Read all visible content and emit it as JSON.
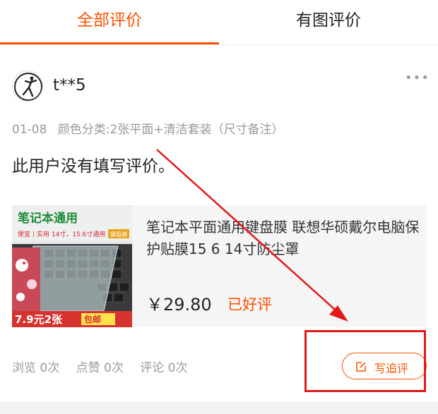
{
  "tabs": [
    {
      "label": "全部评价",
      "active": true
    },
    {
      "label": "有图评价",
      "active": false
    }
  ],
  "review": {
    "username": "t**5",
    "more_icon": "more-horizontal-icon",
    "date": "01-08",
    "sku": "颜色分类:2张平面+清洁套装（尺寸备注）",
    "text": "此用户没有填写评价。"
  },
  "product": {
    "title": "笔记本平面通用键盘膜 联想华硕戴尔电脑保护贴膜15 6 14寸防尘罩",
    "price": "￥29.80",
    "status": "已好评",
    "image_text": {
      "banner": "笔记本通用",
      "subline": "便宜丨实用 14寸，15.6寸通用",
      "tag": "键盘膜",
      "price_tag": "7.9元2张",
      "shipping": "包邮"
    }
  },
  "stats": {
    "views": "浏览 0次",
    "likes": "点赞 0次",
    "comments": "评论 0次"
  },
  "append_button": {
    "label": "写追评",
    "icon": "edit-icon"
  },
  "colors": {
    "accent": "#ff5000",
    "annotation_red": "#e11919",
    "muted": "#999999"
  }
}
